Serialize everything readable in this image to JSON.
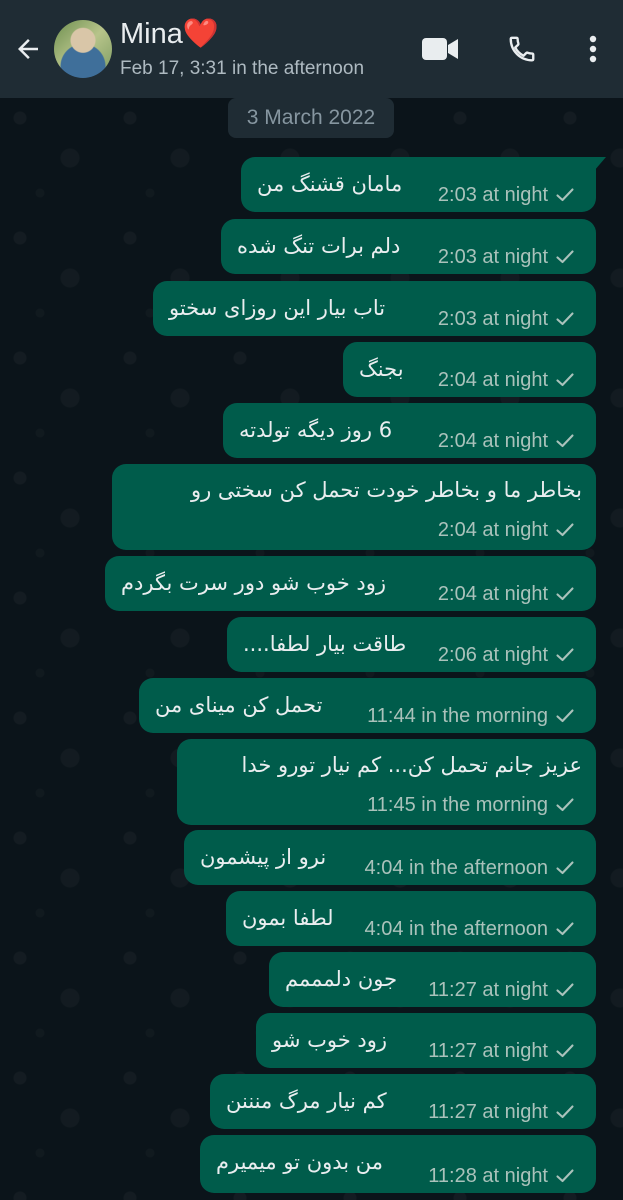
{
  "header": {
    "contact_name": "Mina❤️",
    "status": "Feb 17, 3:31 in the afternoon",
    "icons": [
      "back-arrow-icon",
      "video-call-icon",
      "voice-call-icon",
      "more-options-icon"
    ]
  },
  "date_chip": "3 March 2022",
  "colors": {
    "header_bg": "#1f2c34",
    "chat_bg": "#0b141a",
    "outgoing_bubble": "#005c4b",
    "meta_text": "#aac2bb"
  },
  "messages": [
    {
      "text": "مامان قشنگ من",
      "time": "2:03 at night",
      "status": "sent"
    },
    {
      "text": "دلم برات تنگ شده",
      "time": "2:03 at night",
      "status": "sent"
    },
    {
      "text": "تاب بیار این روزای سختو",
      "time": "2:03 at night",
      "status": "sent"
    },
    {
      "text": "بجنگ",
      "time": "2:04 at night",
      "status": "sent"
    },
    {
      "text": "6 روز دیگه تولدته",
      "time": "2:04 at night",
      "status": "sent"
    },
    {
      "text": "بخاطر ما و بخاطر خودت تحمل کن سختی رو",
      "time": "2:04 at night",
      "status": "sent"
    },
    {
      "text": "زود خوب شو دور سرت بگردم",
      "time": "2:04 at night",
      "status": "sent"
    },
    {
      "text": "طاقت بیار لطفا....",
      "time": "2:06 at night",
      "status": "sent"
    },
    {
      "text": "تحمل کن مینای من",
      "time": "11:44 in the morning",
      "status": "sent"
    },
    {
      "text": "عزیز جانم تحمل کن... کم نیار تورو خدا",
      "time": "11:45 in the morning",
      "status": "sent"
    },
    {
      "text": "نرو از پیشمون",
      "time": "4:04 in the afternoon",
      "status": "sent"
    },
    {
      "text": "لطفا بمون",
      "time": "4:04 in the afternoon",
      "status": "sent"
    },
    {
      "text": "جون دلمممم",
      "time": "11:27 at night",
      "status": "sent"
    },
    {
      "text": "زود خوب شو",
      "time": "11:27 at night",
      "status": "sent"
    },
    {
      "text": "کم نیار مرگ منننن",
      "time": "11:27 at night",
      "status": "sent"
    },
    {
      "text": "من بدون تو میمیرم",
      "time": "11:28 at night",
      "status": "sent"
    }
  ]
}
